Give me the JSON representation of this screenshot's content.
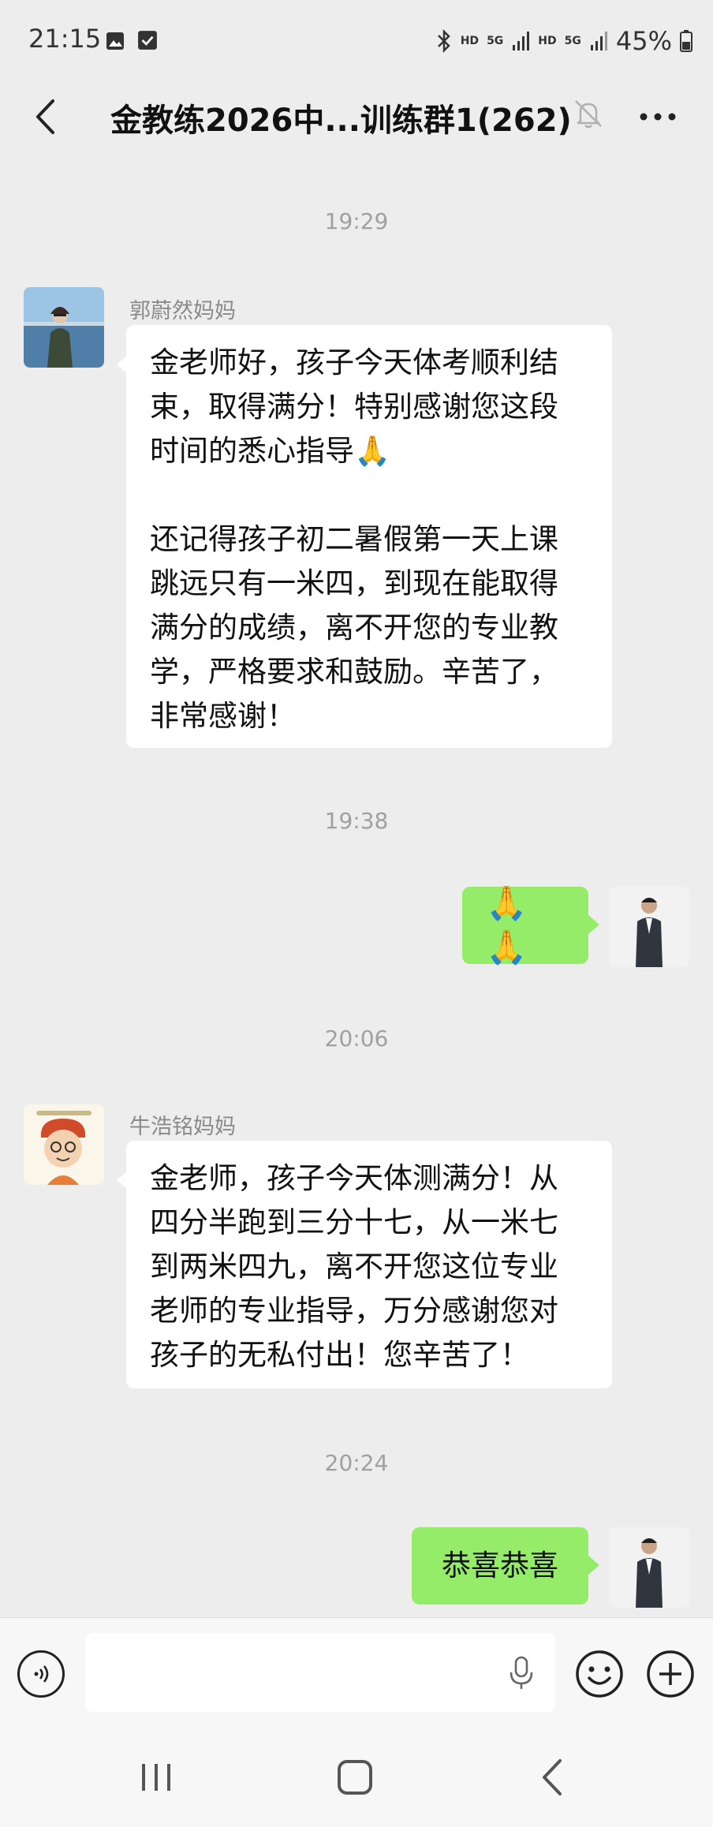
{
  "status_bar": {
    "time": "21:15",
    "net1": "HD",
    "net2": "5G",
    "net3": "HD",
    "net4": "5G",
    "battery": "45%"
  },
  "header": {
    "title": "金教练2026中...训练群1(262)"
  },
  "messages": [
    {
      "type": "time",
      "text": "19:29"
    },
    {
      "type": "incoming",
      "sender": "郭蔚然妈妈",
      "lines": [
        "金老师好，孩子今天体考顺利结",
        "束，取得满分！特别感谢您这段",
        "时间的悉心指导🙏",
        "",
        "还记得孩子初二暑假第一天上课",
        "跳远只有一米四，到现在能取得",
        "满分的成绩，离不开您的专业教",
        "学，严格要求和鼓励。辛苦了，",
        "非常感谢！"
      ]
    },
    {
      "type": "time",
      "text": "19:38"
    },
    {
      "type": "outgoing",
      "text": "🙏🙏"
    },
    {
      "type": "time",
      "text": "20:06"
    },
    {
      "type": "incoming",
      "sender": "牛浩铭妈妈",
      "lines": [
        "金老师，孩子今天体测满分！从",
        "四分半跑到三分十七，从一米七",
        "到两米四九，离不开您这位专业",
        "老师的专业指导，万分感谢您对",
        "孩子的无私付出！您辛苦了！"
      ]
    },
    {
      "type": "time",
      "text": "20:24"
    },
    {
      "type": "outgoing",
      "text": "恭喜恭喜"
    }
  ],
  "input": {
    "value": "",
    "placeholder": ""
  },
  "colors": {
    "background": "#ededed",
    "outgoing_bubble": "#95ec69",
    "incoming_bubble": "#ffffff",
    "timestamp": "#a0a0a0"
  },
  "icons": {
    "back": "chevron-left-icon",
    "mute": "bell-muted-icon",
    "more": "more-dots-icon",
    "voice": "voice-wave-icon",
    "mic": "microphone-icon",
    "emoji": "smile-icon",
    "plus": "plus-circle-icon"
  }
}
